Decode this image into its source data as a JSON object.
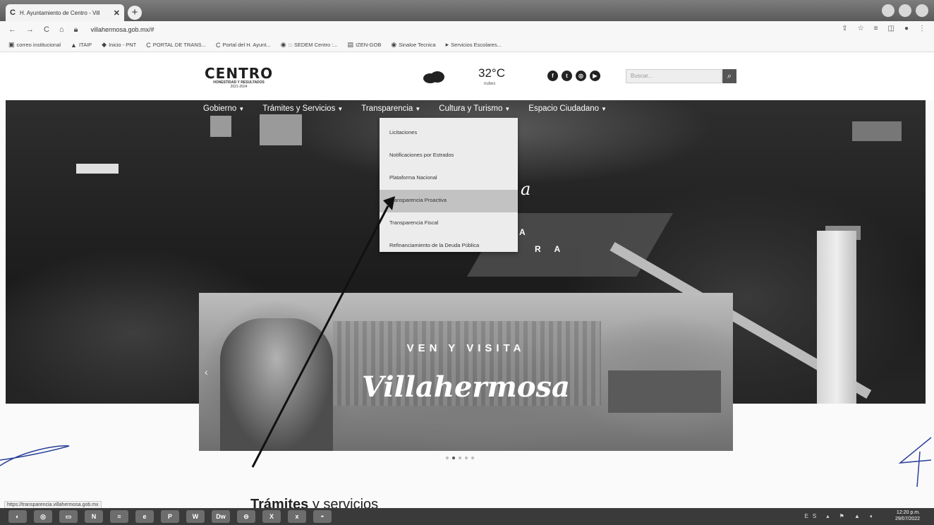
{
  "browser": {
    "tab_title": "H. Ayuntamiento de Centro - Vill",
    "url": "villahermosa.gob.mx/#",
    "bookmarks": [
      {
        "icon": "▣",
        "label": "correo institucional"
      },
      {
        "icon": "▲",
        "label": "ITAIP"
      },
      {
        "icon": "◆",
        "label": "Inicio - PNT"
      },
      {
        "icon": "C",
        "label": "PORTAL DE TRANS..."
      },
      {
        "icon": "C",
        "label": "Portal del H. Ayunt..."
      },
      {
        "icon": "◉",
        "label": "::: SEDEM Centro :..."
      },
      {
        "icon": "▤",
        "label": "IZEN-GOB"
      },
      {
        "icon": "◉",
        "label": "Sinaloe Tecnica"
      },
      {
        "icon": "▸",
        "label": "Servicios Escolares..."
      }
    ],
    "status_url": "https://transparencia.villahermosa.gob.mx"
  },
  "site": {
    "logo": {
      "name": "CENTRO",
      "slogan": "HONESTIDAD Y RESULTADOS",
      "years": "2021-2024"
    },
    "weather": {
      "temperature": "32°C",
      "condition": "nubes"
    },
    "search_placeholder": "Buscar..."
  },
  "nav": [
    {
      "label": "Gobierno"
    },
    {
      "label": "Trámites y Servicios"
    },
    {
      "label": "Transparencia"
    },
    {
      "label": "Cultura y Turismo"
    },
    {
      "label": "Espacio Ciudadano"
    }
  ],
  "dropdown": {
    "items": [
      "Licitaciones",
      "Notificaciones por Estrados",
      "Plataforma Nacional",
      "Transparencia Proactiva",
      "Transparencia Fiscal",
      "Refinanciamiento de la Deuda Pública"
    ],
    "highlighted_index": 3
  },
  "hero": {
    "script_fragment": "a",
    "letter_fragment_1": "A",
    "letter_fragment_2": "R A"
  },
  "banner": {
    "top_text": "VEN Y VISITA",
    "script_text": "Villahermosa",
    "slide_count": 5,
    "active_slide": 1
  },
  "section": {
    "title_bold": "Trámites",
    "title_rest": " y servicios"
  },
  "taskbar": {
    "time": "12:20 p.m.",
    "date": "29/07/2022",
    "apps": [
      "◐",
      "◎",
      "▭",
      "N",
      "≡",
      "e",
      "P",
      "W",
      "Dw",
      "⊖",
      "X",
      "x",
      "◓"
    ]
  }
}
